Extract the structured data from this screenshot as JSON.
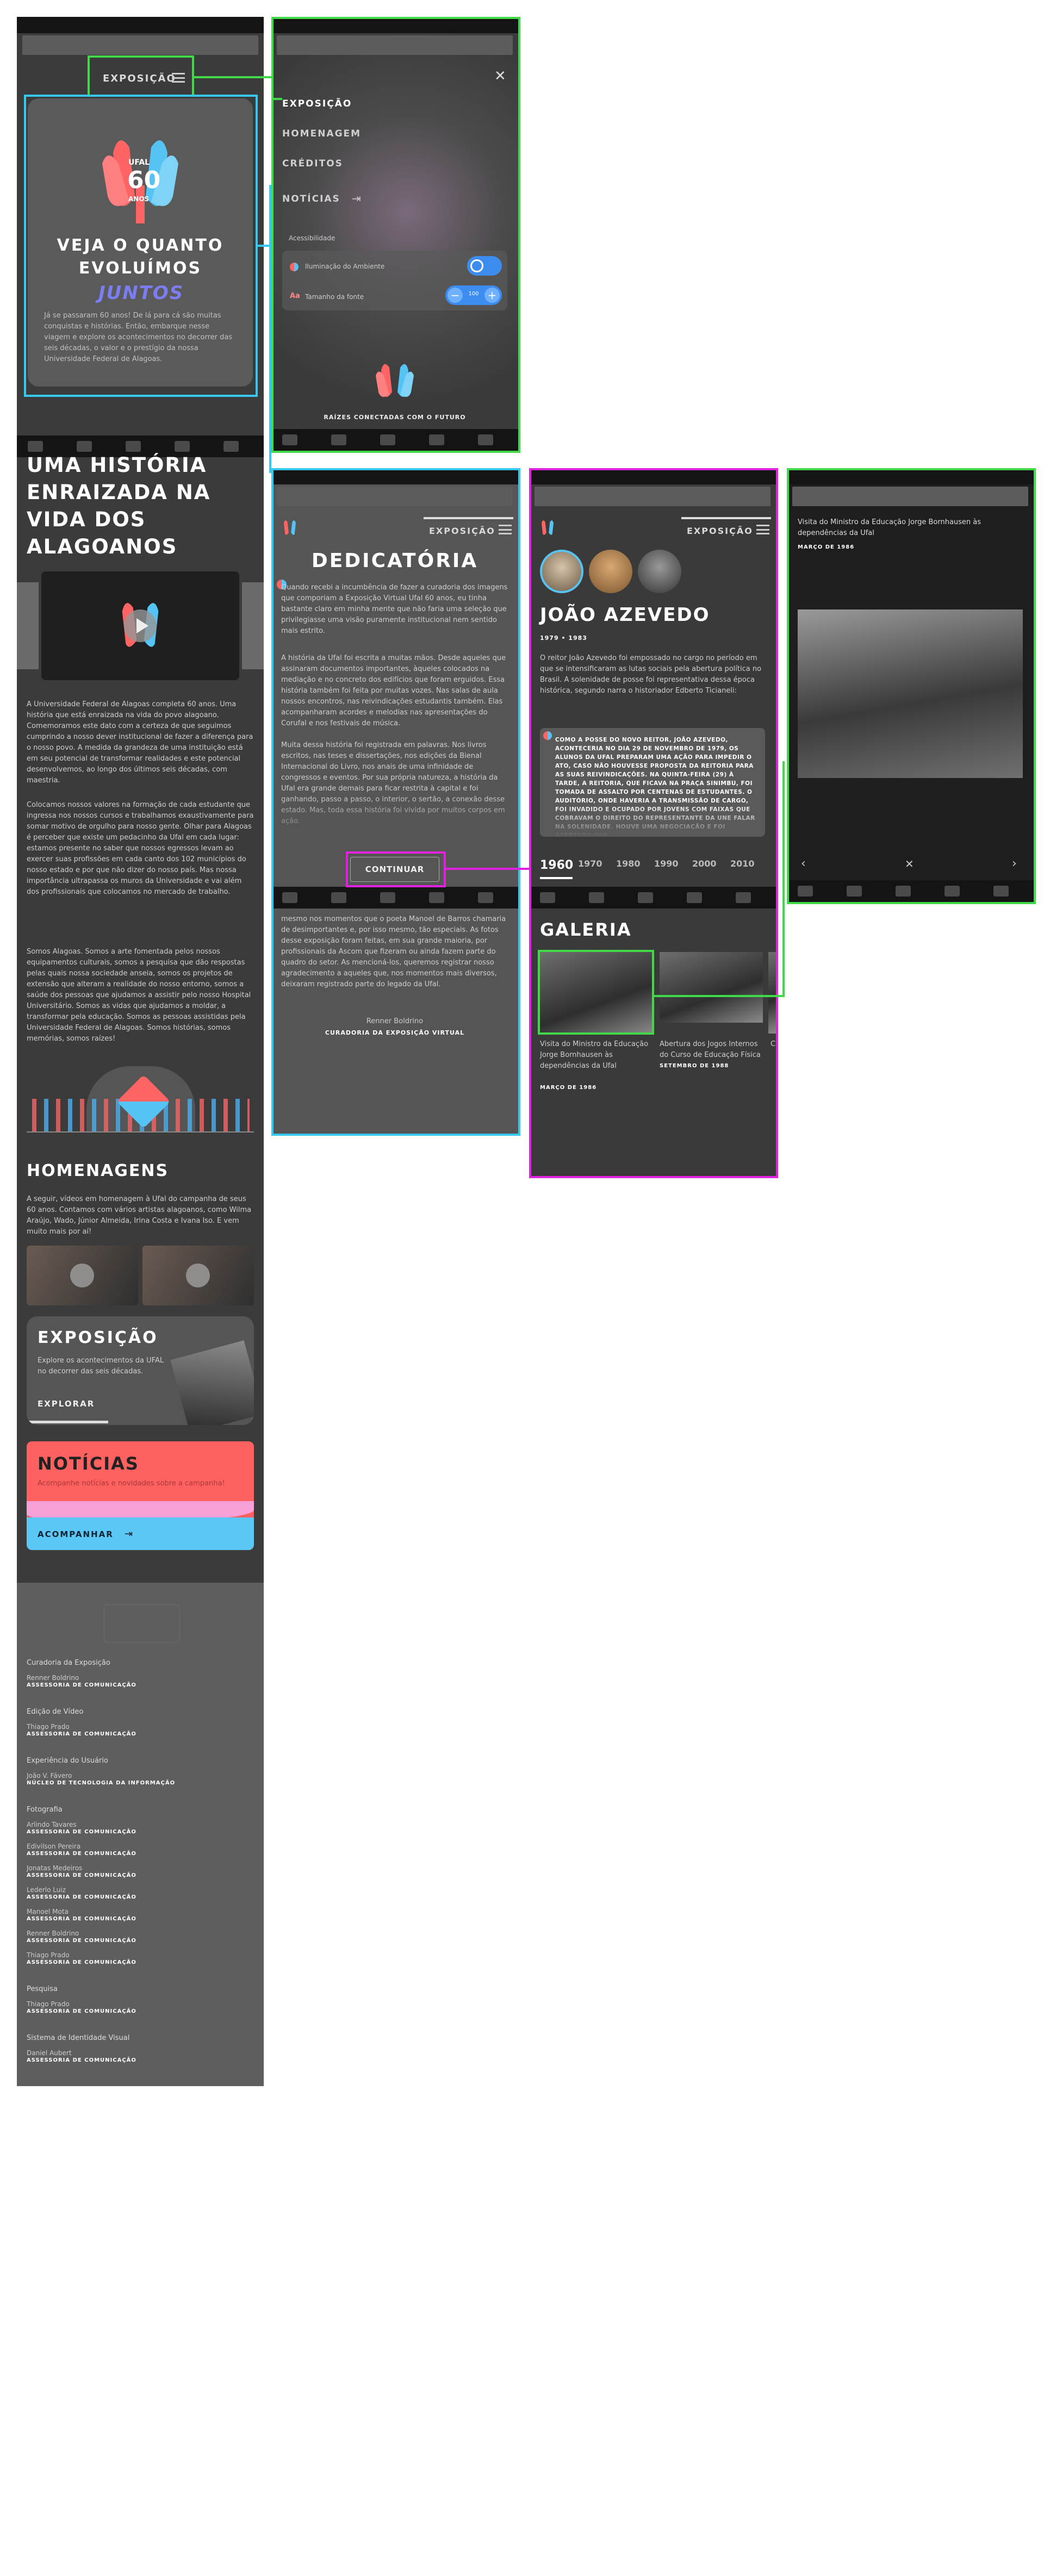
{
  "brand": {
    "colors": {
      "accent_red": "#ff6060",
      "accent_blue": "#55c4f4",
      "outline_green": "#41d94a",
      "outline_cyan": "#35c9ef",
      "outline_magenta": "#e021e0",
      "bg_dark": "#3a3a3a"
    },
    "logo_icon": "ufal-hands-logo-icon",
    "ufal_text": "UFAL",
    "years": "60",
    "anos": "ANOS"
  },
  "header": {
    "exposicao_link": "EXPOSIÇÃO",
    "menu_icon": "hamburger-icon"
  },
  "home": {
    "hero_title": "VEJA O QUANTO EVOLUÍMOS",
    "hero_subtitle_art": "JUNTOS",
    "hero_text": "Já se passaram 60 anos! De lá para cá são muitas conquistas e histórias. Então, embarque nesse viagem e explore os acontecimentos no decorrer das seis décadas, o valor e o prestígio da nossa Universidade Federal de Alagoas.",
    "history_title": "UMA HISTÓRIA ENRAIZADA NA VIDA DOS ALAGOANOS",
    "history_p1": "A Universidade Federal de Alagoas completa 60 anos. Uma história que está enraizada na vida do povo alagoano. Comemoramos este dato com a certeza de que seguimos cumprindo a nosso dever institucional de fazer a diferença para o nosso povo. A medida da grandeza de uma instituição está em seu potencial de transformar realidades e este potencial desenvolvemos, ao longo dos últimos seis décadas, com maestria.",
    "history_p2": "Colocamos nossos valores na formação de cada estudante que ingressa nos nossos cursos e trabalhamos exaustivamente para somar motivo de orgulho para nosso gente. Olhar para Alagoas é perceber que existe um pedacinho da Ufal em cada lugar: estamos presente no saber que nossos egressos levam ao exercer suas profissões em cada canto dos 102 municípios do nosso estado e por que não dizer do nosso país. Mas nossa importância ultrapassa os muros da Universidade e vai além dos profissionais que colocamos no mercado de trabalho.",
    "history_p3": "Somos Alagoas. Somos a arte fomentada pelos nossos equipamentos culturais, somos a pesquisa que dão respostas pelas quais nossa sociedade anseia, somos os projetos de extensão que alteram a realidade do nosso entorno, somos a saúde dos pessoas que ajudamos a assistir pelo nosso Hospital Universitário. Somos as vidas que ajudamos a moldar, a transformar pela educação. Somos as pessoas assistidas pela Universidade Federal de Alagoas. Somos histórias, somos memórias, somos raízes!",
    "homenagens_title": "HOMENAGENS",
    "homenagens_text": "A seguir, vídeos em homenagem à Ufal do campanha de seus 60 anos. Contamos com vários artistas alagoanos, como Wilma Araújo, Wado, Júnior Almeida, Irina Costa e Ivana Iso. E vem muito mais por aí!",
    "exposicao_card_title": "EXPOSIÇÃO",
    "exposicao_card_text": "Explore os acontecimentos da UFAL no decorrer das seis décadas.",
    "explorar_button": "EXPLORAR",
    "noticias_title": "NOTÍCIAS",
    "noticias_text": "Acompanhe notícias e novidades sobre a campanha!",
    "acompanhar_button": "ACOMPANHAR",
    "credits": [
      {
        "role": "Curadoria da Exposição",
        "people": [
          {
            "name": "Renner Boldrino",
            "dept": "ASSESSORIA DE COMUNICAÇÃO"
          }
        ]
      },
      {
        "role": "Edição de Vídeo",
        "people": [
          {
            "name": "Thiago Prado",
            "dept": "ASSESSORIA DE COMUNICAÇÃO"
          }
        ]
      },
      {
        "role": "Experiência do Usuário",
        "people": [
          {
            "name": "João V. Fávero",
            "dept": "NÚCLEO DE TECNOLOGIA DA INFORMAÇÃO"
          }
        ]
      },
      {
        "role": "Fotografia",
        "people": [
          {
            "name": "Arlindo Tavares",
            "dept": "ASSESSORIA DE COMUNICAÇÃO"
          },
          {
            "name": "Edivilson Pereira",
            "dept": "ASSESSORIA DE COMUNICAÇÃO"
          },
          {
            "name": "Jonatas Medeiros",
            "dept": "ASSESSORIA DE COMUNICAÇÃO"
          },
          {
            "name": "Lederlo Luiz",
            "dept": "ASSESSORIA DE COMUNICAÇÃO"
          },
          {
            "name": "Manoel Mota",
            "dept": "ASSESSORIA DE COMUNICAÇÃO"
          },
          {
            "name": "Renner Boldrino",
            "dept": "ASSESSORIA DE COMUNICAÇÃO"
          },
          {
            "name": "Thiago Prado",
            "dept": "ASSESSORIA DE COMUNICAÇÃO"
          }
        ]
      },
      {
        "role": "Pesquisa",
        "people": [
          {
            "name": "Thiago Prado",
            "dept": "ASSESSORIA DE COMUNICAÇÃO"
          }
        ]
      },
      {
        "role": "Sistema de Identidade Visual",
        "people": [
          {
            "name": "Daniel Aubert",
            "dept": "ASSESSORIA DE COMUNICAÇÃO"
          }
        ]
      }
    ]
  },
  "menu": {
    "items": [
      "EXPOSIÇÃO",
      "HOMENAGEM",
      "CRÉDITOS",
      "NOTÍCIAS"
    ],
    "accessibility_label": "Acessibilidade",
    "contrast_label": "Iluminação do Ambiente",
    "font_label": "Tamanho da fonte",
    "font_value": "100",
    "footer_tagline": "RAÍZES CONECTADAS COM O FUTURO"
  },
  "dedicatoria": {
    "title": "DEDICATÓRIA",
    "p1": "Quando recebi a incumbência de fazer a curadoria dos imagens que comporiam a Exposição Virtual Ufal 60 anos, eu tinha bastante claro em minha mente que não faria uma seleção que privilegiasse uma visão puramente institucional nem sentido mais estrito.",
    "p2": "A história da Ufal foi escrita a muitas mãos. Desde aqueles que assinaram documentos importantes, àqueles colocados na mediação e no concreto dos edifícios que foram erguidos. Essa história também foi feita por muitas vozes. Nas salas de aula nossos encontros, nas reivindicações estudantis também. Elas acompanharam acordes e melodias nas apresentações do Corufal e nos festivais de música.",
    "p3": "Muita dessa história foi registrada em palavras. Nos livros escritos, nas teses e dissertações, nos edições da Bienal Internacional do Livro, nos anais de uma infinidade de congressos e eventos. Por sua própria natureza, a história da Ufal era grande demais para ficar restrita à capital e foi ganhando, passo a passo, o interior, o sertão, a conexão desse estado. Mas, toda essa história foi vivida por muitos corpos em ação.",
    "p4": "mesmo nos momentos que o poeta Manoel de Barros chamaria de desimportantes e, por isso mesmo, tão especiais. As fotos desse exposição foram feitas, em sua grande maioria, por profissionais da Ascom que fizeram ou ainda fazem parte do quadro do setor. As mencioná-los, queremos registrar nosso agradecimento a aqueles que, nos momentos mais diversos, deixaram registrado parte do legado da Ufal.",
    "signature_name": "Renner Boldrino",
    "signature_role": "CURADORIA DA EXPOSIÇÃO VIRTUAL",
    "continue_button": "CONTINUAR"
  },
  "rector": {
    "name": "JOÃO AZEVEDO",
    "years": "1979 • 1983",
    "text": "O reitor João Azevedo foi empossado no cargo no período em que se intensificaram as lutas sociais pela abertura política no Brasil. A solenidade de posse foi representativa dessa época histórica, segundo narra o historiador Edberto Ticianeli:",
    "quote": "COMO A POSSE DO NOVO REITOR, JOÃO AZEVEDO, ACONTECERIA NO DIA 29 DE NOVEMBRO DE 1979, OS ALUNOS DA UFAL PREPARAM UMA AÇÃO PARA IMPEDIR O ATO, CASO NÃO HOUVESSE PROPOSTA DA REITORIA PARA AS SUAS REIVINDICAÇÕES. NA QUINTA-FEIRA (29) À TARDE, A REITORIA, QUE FICAVA NA PRAÇA SINIMBU, FOI TOMADA DE ASSALTO POR CENTENAS DE ESTUDANTES. O AUDITÓRIO, ONDE HAVERIA A TRANSMISSÃO DE CARGO, FOI INVADIDO E OCUPADO POR JOVENS COM FAIXAS QUE COBRAVAM O DIREITO DO REPRESENTANTE DA UNE FALAR NA SOLENIDADE. HOUVE UMA NEGOCIAÇÃO E FOI ACERTADO QUE",
    "decades": [
      "1960",
      "1970",
      "1980",
      "1990",
      "2000",
      "2010"
    ],
    "galeria_title": "GALERIA",
    "gallery": [
      {
        "caption": "Visita do Ministro da Educação Jorge Bornhausen às dependências da Ufal",
        "date": "MARÇO DE 1986"
      },
      {
        "caption": "Abertura dos Jogos Internos do Curso de Educação Física",
        "date": "SETEMBRO DE 1988"
      },
      {
        "caption": "C",
        "date": ""
      }
    ]
  },
  "lightbox": {
    "caption": "Visita do Ministro da Educação Jorge Bornhausen às dependências da Ufal",
    "date": "MARÇO DE 1986"
  }
}
